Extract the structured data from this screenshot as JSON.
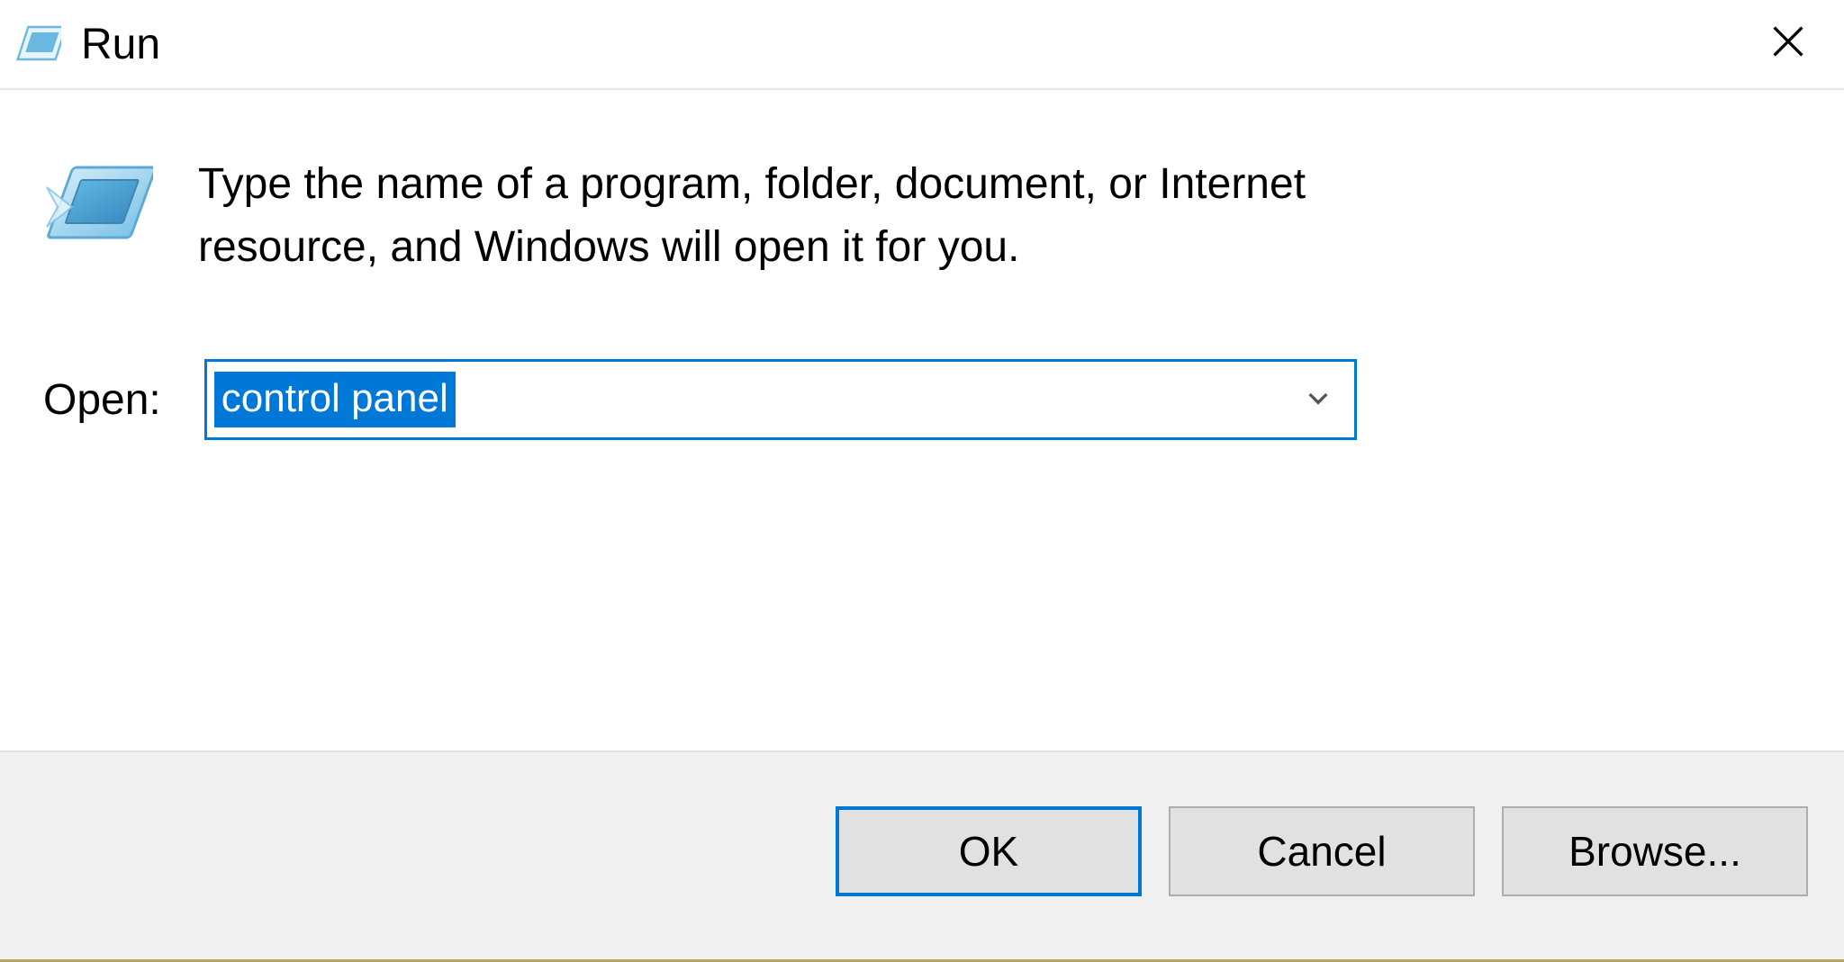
{
  "titlebar": {
    "title": "Run"
  },
  "description": "Type the name of a program, folder, document, or Internet resource, and Windows will open it for you.",
  "open_label": "Open:",
  "input_value": "control panel",
  "buttons": {
    "ok": "OK",
    "cancel": "Cancel",
    "browse": "Browse..."
  }
}
